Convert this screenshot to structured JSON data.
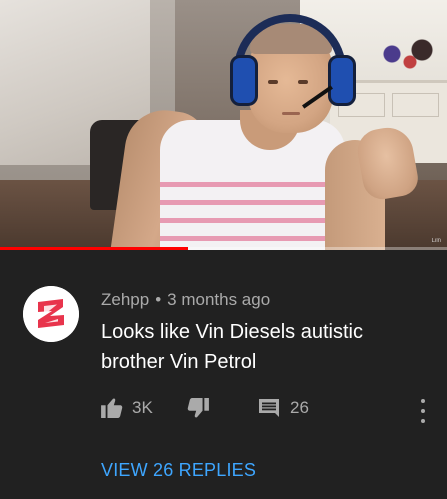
{
  "video": {
    "watermark": "Liln",
    "progress_fraction": 0.42
  },
  "comment": {
    "author": "Zehpp",
    "separator": "•",
    "time": "3 months ago",
    "text": "Looks like Vin Diesels autistic brother Vin Petrol",
    "likes": "3K",
    "replies_count": "26",
    "view_replies": "VIEW 26 REPLIES"
  },
  "icons": {
    "like": "thumbs-up-icon",
    "dislike": "thumbs-down-icon",
    "reply": "comment-icon",
    "more": "more-vert-icon",
    "avatar": "channel-avatar-z-logo"
  },
  "colors": {
    "background": "#212121",
    "primary_text": "#ffffff",
    "secondary_text": "#aaaaaa",
    "link": "#3ea6ff",
    "progress": "#ff0000",
    "avatar_logo": "#e8344c"
  }
}
